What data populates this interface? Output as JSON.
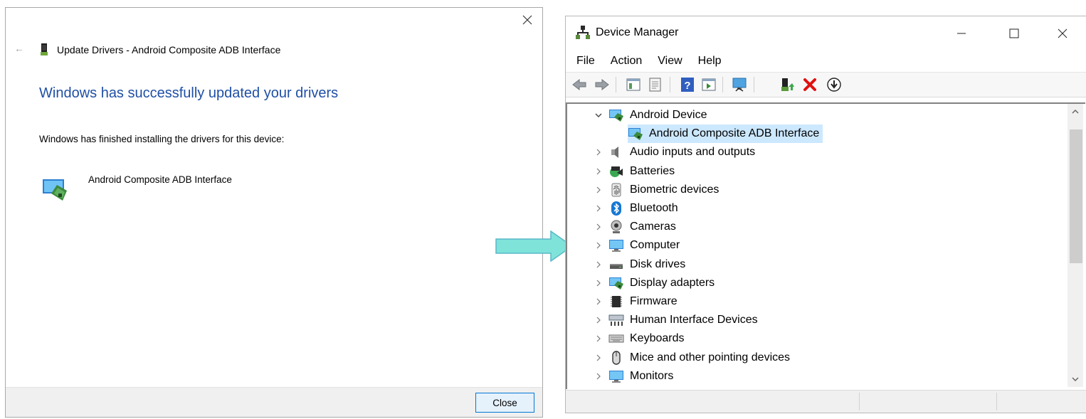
{
  "dialog": {
    "back_glyph": "←",
    "header_title": "Update Drivers - Android Composite ADB Interface",
    "heading": "Windows has successfully updated your drivers",
    "description": "Windows has finished installing the drivers for this device:",
    "device_name": "Android Composite ADB Interface",
    "close_button": "Close"
  },
  "device_manager": {
    "title": "Device Manager",
    "menu": [
      "File",
      "Action",
      "View",
      "Help"
    ],
    "tree": [
      {
        "label": "Android Device",
        "expanded": true,
        "icon": "display-adapter-icon"
      },
      {
        "label": "Android Composite ADB Interface",
        "selected": true,
        "child": true,
        "icon": "display-adapter-icon"
      },
      {
        "label": "Audio inputs and outputs",
        "icon": "speaker-icon"
      },
      {
        "label": "Batteries",
        "icon": "battery-icon"
      },
      {
        "label": "Biometric devices",
        "icon": "fingerprint-icon"
      },
      {
        "label": "Bluetooth",
        "icon": "bluetooth-icon"
      },
      {
        "label": "Cameras",
        "icon": "webcam-icon"
      },
      {
        "label": "Computer",
        "icon": "monitor-icon"
      },
      {
        "label": "Disk drives",
        "icon": "disk-drive-icon"
      },
      {
        "label": "Display adapters",
        "icon": "display-adapter-icon"
      },
      {
        "label": "Firmware",
        "icon": "chip-icon"
      },
      {
        "label": "Human Interface Devices",
        "icon": "hid-icon"
      },
      {
        "label": "Keyboards",
        "icon": "keyboard-icon"
      },
      {
        "label": "Mice and other pointing devices",
        "icon": "mouse-icon"
      },
      {
        "label": "Monitors",
        "icon": "monitor-icon"
      }
    ]
  },
  "colors": {
    "heading_blue": "#1f4fa5",
    "selection": "#cce8ff",
    "arrow_fill": "#7fe3d9"
  }
}
